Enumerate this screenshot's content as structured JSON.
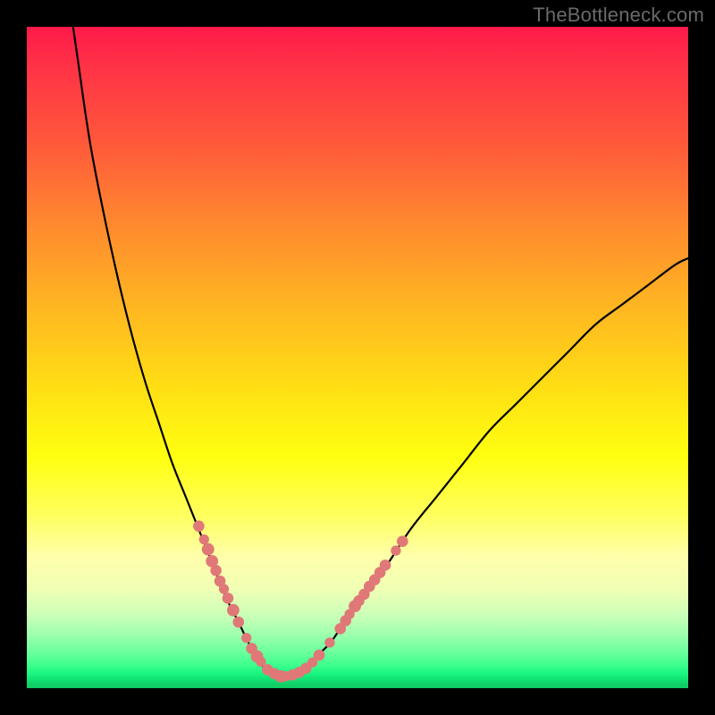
{
  "watermark": "TheBottleneck.com",
  "colors": {
    "frame": "#000000",
    "curve": "#000000",
    "dots": "#e07878",
    "watermark": "#6a6a6a",
    "gradient_stops": [
      "#ff1a4a",
      "#ff3246",
      "#ff5a3a",
      "#ff8a2e",
      "#ffb522",
      "#ffe014",
      "#ffff10",
      "#ffff60",
      "#ffffaa",
      "#f0ffb4",
      "#caffb8",
      "#9cffae",
      "#6cff9e",
      "#3dff8e",
      "#18f57e",
      "#12e474",
      "#10d46a",
      "#0fc862"
    ]
  },
  "chart_data": {
    "type": "line",
    "title": "",
    "xlabel": "",
    "ylabel": "",
    "xlim": [
      0,
      100
    ],
    "ylim": [
      0,
      100
    ],
    "grid": false,
    "legend": false,
    "curve": {
      "description": "V-shaped bottleneck curve, minimum near x≈38, left arm steep, right arm gentler",
      "points": [
        {
          "x": 7,
          "y": 100
        },
        {
          "x": 8,
          "y": 93
        },
        {
          "x": 9,
          "y": 86
        },
        {
          "x": 10,
          "y": 80
        },
        {
          "x": 12,
          "y": 70
        },
        {
          "x": 14,
          "y": 61
        },
        {
          "x": 16,
          "y": 53
        },
        {
          "x": 18,
          "y": 46
        },
        {
          "x": 20,
          "y": 40
        },
        {
          "x": 22,
          "y": 34
        },
        {
          "x": 24,
          "y": 29
        },
        {
          "x": 26,
          "y": 24
        },
        {
          "x": 28,
          "y": 19
        },
        {
          "x": 30,
          "y": 14
        },
        {
          "x": 32,
          "y": 10
        },
        {
          "x": 34,
          "y": 6
        },
        {
          "x": 36,
          "y": 3
        },
        {
          "x": 38,
          "y": 2
        },
        {
          "x": 40,
          "y": 2
        },
        {
          "x": 42,
          "y": 3
        },
        {
          "x": 44,
          "y": 5
        },
        {
          "x": 46,
          "y": 7
        },
        {
          "x": 48,
          "y": 10
        },
        {
          "x": 50,
          "y": 13
        },
        {
          "x": 54,
          "y": 18
        },
        {
          "x": 58,
          "y": 24
        },
        {
          "x": 62,
          "y": 29
        },
        {
          "x": 66,
          "y": 34
        },
        {
          "x": 70,
          "y": 39
        },
        {
          "x": 74,
          "y": 43
        },
        {
          "x": 78,
          "y": 47
        },
        {
          "x": 82,
          "y": 51
        },
        {
          "x": 86,
          "y": 55
        },
        {
          "x": 90,
          "y": 58
        },
        {
          "x": 94,
          "y": 61
        },
        {
          "x": 98,
          "y": 64
        },
        {
          "x": 100,
          "y": 65
        }
      ]
    },
    "dots": {
      "description": "Salmon-pink data markers along the lower portion of the curve",
      "points": [
        {
          "x": 26.0,
          "y": 24.5,
          "r": 1.0
        },
        {
          "x": 26.8,
          "y": 22.5,
          "r": 0.9
        },
        {
          "x": 27.4,
          "y": 21.0,
          "r": 1.1
        },
        {
          "x": 28.0,
          "y": 19.2,
          "r": 1.1
        },
        {
          "x": 28.6,
          "y": 17.8,
          "r": 1.0
        },
        {
          "x": 29.2,
          "y": 16.2,
          "r": 1.0
        },
        {
          "x": 29.8,
          "y": 15.0,
          "r": 0.9
        },
        {
          "x": 30.4,
          "y": 13.6,
          "r": 1.0
        },
        {
          "x": 31.2,
          "y": 11.8,
          "r": 1.1
        },
        {
          "x": 32.0,
          "y": 10.0,
          "r": 1.0
        },
        {
          "x": 33.2,
          "y": 7.6,
          "r": 0.9
        },
        {
          "x": 34.0,
          "y": 6.0,
          "r": 1.0
        },
        {
          "x": 34.8,
          "y": 4.8,
          "r": 1.1
        },
        {
          "x": 35.4,
          "y": 4.0,
          "r": 0.9
        },
        {
          "x": 36.4,
          "y": 2.8,
          "r": 1.0
        },
        {
          "x": 37.4,
          "y": 2.2,
          "r": 1.0
        },
        {
          "x": 38.4,
          "y": 1.8,
          "r": 1.1
        },
        {
          "x": 39.2,
          "y": 1.8,
          "r": 0.9
        },
        {
          "x": 40.2,
          "y": 2.0,
          "r": 1.0
        },
        {
          "x": 41.2,
          "y": 2.4,
          "r": 1.0
        },
        {
          "x": 42.2,
          "y": 3.0,
          "r": 1.0
        },
        {
          "x": 43.2,
          "y": 3.9,
          "r": 0.9
        },
        {
          "x": 44.2,
          "y": 5.0,
          "r": 1.0
        },
        {
          "x": 45.8,
          "y": 6.9,
          "r": 0.9
        },
        {
          "x": 47.4,
          "y": 9.0,
          "r": 1.0
        },
        {
          "x": 48.2,
          "y": 10.2,
          "r": 1.0
        },
        {
          "x": 48.8,
          "y": 11.2,
          "r": 0.9
        },
        {
          "x": 49.6,
          "y": 12.4,
          "r": 1.1
        },
        {
          "x": 50.2,
          "y": 13.2,
          "r": 1.0
        },
        {
          "x": 51.0,
          "y": 14.2,
          "r": 1.0
        },
        {
          "x": 51.8,
          "y": 15.4,
          "r": 1.0
        },
        {
          "x": 52.6,
          "y": 16.4,
          "r": 1.0
        },
        {
          "x": 53.4,
          "y": 17.5,
          "r": 1.0
        },
        {
          "x": 54.2,
          "y": 18.6,
          "r": 1.0
        },
        {
          "x": 55.8,
          "y": 20.8,
          "r": 0.9
        },
        {
          "x": 56.8,
          "y": 22.2,
          "r": 1.0
        }
      ]
    }
  }
}
